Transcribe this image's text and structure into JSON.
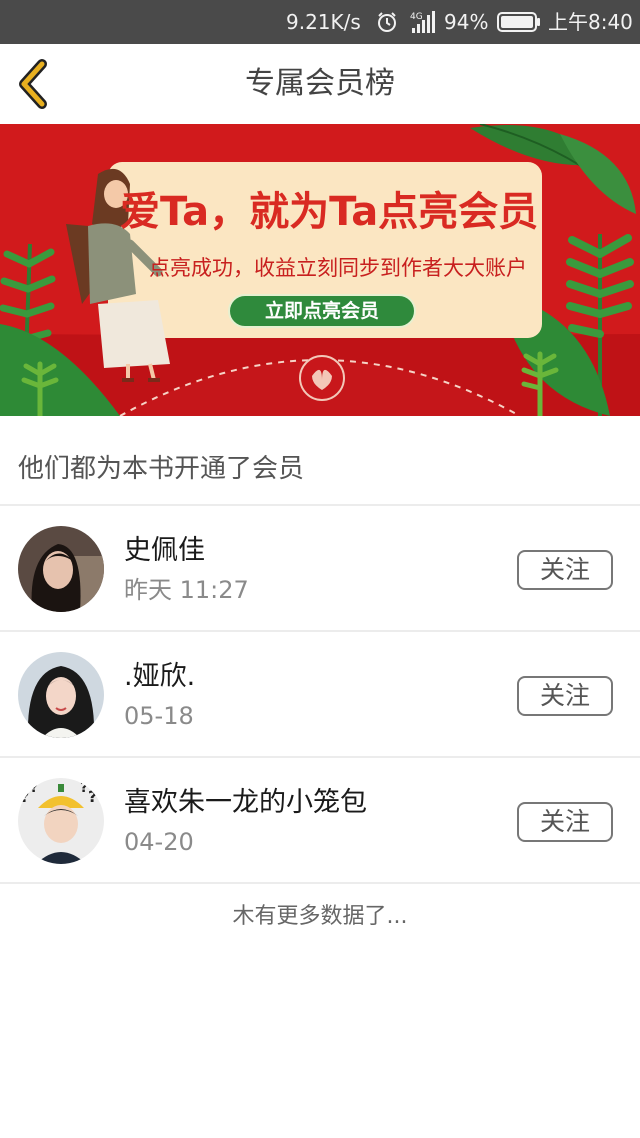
{
  "status_bar": {
    "net_speed": "9.21K/s",
    "signal_label": "4G",
    "battery_percent": "94%",
    "time": "上午8:40",
    "icons": [
      "alarm-icon",
      "signal-icon",
      "battery-icon"
    ]
  },
  "header": {
    "title": "专属会员榜",
    "back_icon": "chevron-left-icon",
    "accent": "#e8b020"
  },
  "banner": {
    "headline": "爱Ta，就为Ta点亮会员",
    "subtitle": "点亮成功，收益立刻同步到作者大大账户",
    "button_label": "立即点亮会员",
    "colors": {
      "background": "#d11a1c",
      "card": "#fbe6c2",
      "button": "#2f8a3c"
    }
  },
  "section": {
    "title": "他们都为本书开通了会员"
  },
  "members": [
    {
      "name": "史佩佳",
      "time": "昨天 11:27",
      "follow_label": "关注"
    },
    {
      "name": ".娅欣.",
      "time": "05-18",
      "follow_label": "关注"
    },
    {
      "name": "喜欢朱一龙的小笼包",
      "time": "04-20",
      "follow_label": "关注"
    }
  ],
  "footer": {
    "no_more_text": "木有更多数据了..."
  }
}
